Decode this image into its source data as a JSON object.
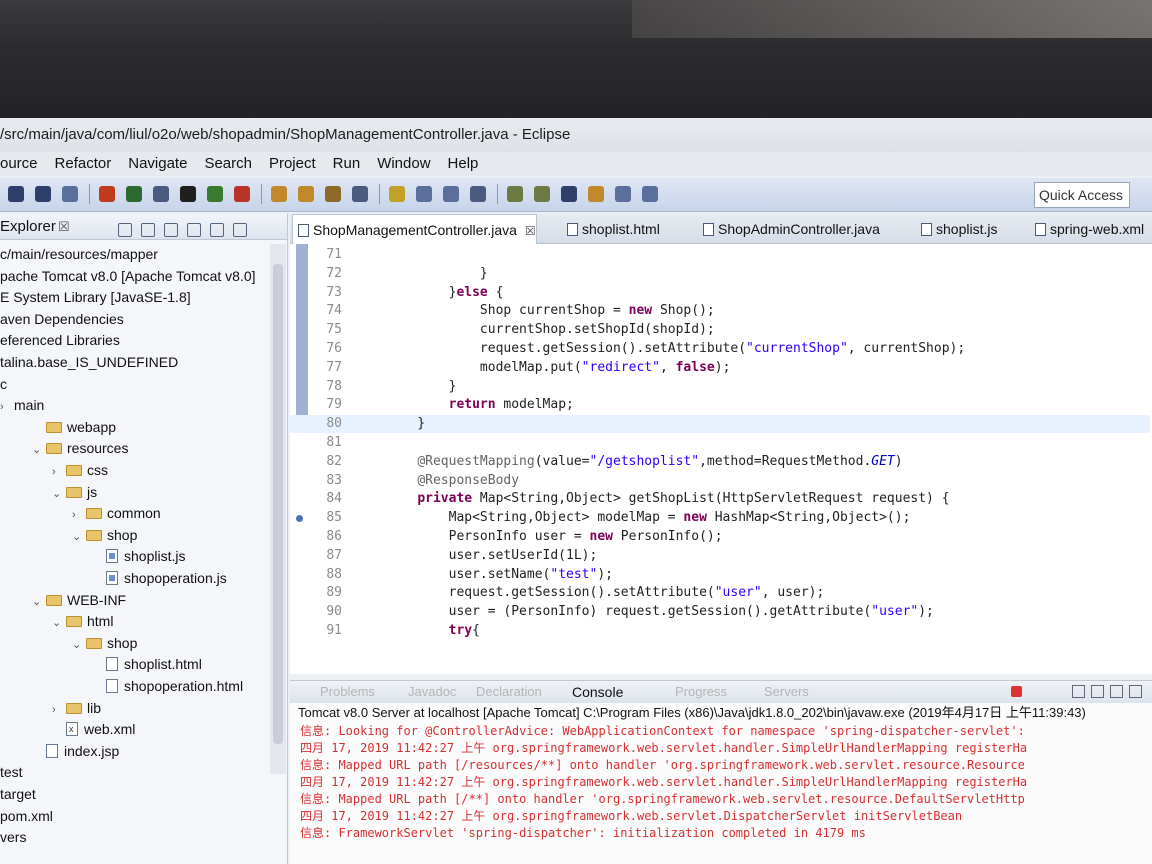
{
  "window": {
    "title": "/src/main/java/com/liul/o2o/web/shopadmin/ShopManagementController.java - Eclipse"
  },
  "menu": [
    "ource",
    "Refactor",
    "Navigate",
    "Search",
    "Project",
    "Run",
    "Window",
    "Help"
  ],
  "toolbar": {
    "quick_access": "Quick Access"
  },
  "explorer": {
    "title": "Explorer",
    "items": [
      {
        "label": "c/main/resources/mapper",
        "indent": 0,
        "type": "text"
      },
      {
        "label": "pache Tomcat v8.0 [Apache Tomcat v8.0]",
        "indent": 0,
        "type": "text"
      },
      {
        "label": "E System Library [JavaSE-1.8]",
        "indent": 0,
        "type": "text"
      },
      {
        "label": "aven Dependencies",
        "indent": 0,
        "type": "text"
      },
      {
        "label": "eferenced Libraries",
        "indent": 0,
        "type": "text"
      },
      {
        "label": "talina.base_IS_UNDEFINED",
        "indent": 0,
        "type": "text"
      },
      {
        "label": "c",
        "indent": 0,
        "type": "text"
      },
      {
        "label": "main",
        "indent": 0,
        "type": "text",
        "arrow": "›"
      },
      {
        "label": "webapp",
        "indent": 1,
        "type": "folder"
      },
      {
        "label": "resources",
        "indent": 1,
        "type": "folder",
        "arrow": "⌄"
      },
      {
        "label": "css",
        "indent": 2,
        "type": "folder",
        "arrow": "›"
      },
      {
        "label": "js",
        "indent": 2,
        "type": "folder",
        "arrow": "⌄"
      },
      {
        "label": "common",
        "indent": 3,
        "type": "folder",
        "arrow": "›"
      },
      {
        "label": "shop",
        "indent": 3,
        "type": "folder",
        "arrow": "⌄"
      },
      {
        "label": "shoplist.js",
        "indent": 4,
        "type": "js"
      },
      {
        "label": "shopoperation.js",
        "indent": 4,
        "type": "js"
      },
      {
        "label": "WEB-INF",
        "indent": 1,
        "type": "folder",
        "arrow": "⌄"
      },
      {
        "label": "html",
        "indent": 2,
        "type": "folder",
        "arrow": "⌄"
      },
      {
        "label": "shop",
        "indent": 3,
        "type": "folder",
        "arrow": "⌄"
      },
      {
        "label": "shoplist.html",
        "indent": 4,
        "type": "file"
      },
      {
        "label": "shopoperation.html",
        "indent": 4,
        "type": "file"
      },
      {
        "label": "lib",
        "indent": 2,
        "type": "folder",
        "arrow": "›"
      },
      {
        "label": "web.xml",
        "indent": 2,
        "type": "x"
      },
      {
        "label": "index.jsp",
        "indent": 1,
        "type": "file"
      },
      {
        "label": "test",
        "indent": 0,
        "type": "text"
      },
      {
        "label": "target",
        "indent": 0,
        "type": "text"
      },
      {
        "label": "pom.xml",
        "indent": 0,
        "type": "text"
      },
      {
        "label": "vers",
        "indent": 0,
        "type": "text"
      }
    ]
  },
  "editor": {
    "tabs": [
      {
        "label": "ShopManagementController.java",
        "close": "☒"
      },
      {
        "label": "shoplist.html"
      },
      {
        "label": "ShopAdminController.java"
      },
      {
        "label": "shoplist.js"
      },
      {
        "label": "spring-web.xml"
      }
    ],
    "lines": [
      {
        "n": "71",
        "code": ""
      },
      {
        "n": "72",
        "code": "            }"
      },
      {
        "n": "73",
        "code": "        }else {"
      },
      {
        "n": "74",
        "code": "            Shop currentShop = new Shop();"
      },
      {
        "n": "75",
        "code": "            currentShop.setShopId(shopId);"
      },
      {
        "n": "76",
        "code": "            request.getSession().setAttribute(\"currentShop\", currentShop);"
      },
      {
        "n": "77",
        "code": "            modelMap.put(\"redirect\", false);"
      },
      {
        "n": "78",
        "code": "        }"
      },
      {
        "n": "79",
        "code": "        return modelMap;"
      },
      {
        "n": "80",
        "code": "    }"
      },
      {
        "n": "81",
        "code": ""
      },
      {
        "n": "82",
        "code": "    @RequestMapping(value=\"/getshoplist\",method=RequestMethod.GET)"
      },
      {
        "n": "83",
        "code": "    @ResponseBody"
      },
      {
        "n": "84",
        "code": "    private Map<String,Object> getShopList(HttpServletRequest request) {"
      },
      {
        "n": "85",
        "code": "        Map<String,Object> modelMap = new HashMap<String,Object>();"
      },
      {
        "n": "86",
        "code": "        PersonInfo user = new PersonInfo();"
      },
      {
        "n": "87",
        "code": "        user.setUserId(1L);"
      },
      {
        "n": "88",
        "code": "        user.setName(\"test\");"
      },
      {
        "n": "89",
        "code": "        request.getSession().setAttribute(\"user\", user);"
      },
      {
        "n": "90",
        "code": "        user = (PersonInfo) request.getSession().getAttribute(\"user\");"
      },
      {
        "n": "91",
        "code": "        try{"
      }
    ]
  },
  "console": {
    "tabs": [
      "Problems",
      "Javadoc",
      "Declaration",
      "Console",
      "Progress",
      "Servers"
    ],
    "active_tab": "Console",
    "title": "Tomcat v8.0 Server at localhost [Apache Tomcat] C:\\Program Files (x86)\\Java\\jdk1.8.0_202\\bin\\javaw.exe (2019年4月17日 上午11:39:43)",
    "lines": [
      "信息: Looking for @ControllerAdvice: WebApplicationContext for namespace 'spring-dispatcher-servlet':",
      "四月 17, 2019 11:42:27 上午 org.springframework.web.servlet.handler.SimpleUrlHandlerMapping registerHa",
      "信息: Mapped URL path [/resources/**] onto handler 'org.springframework.web.servlet.resource.Resource",
      "四月 17, 2019 11:42:27 上午 org.springframework.web.servlet.handler.SimpleUrlHandlerMapping registerHa",
      "信息: Mapped URL path [/**] onto handler 'org.springframework.web.servlet.resource.DefaultServletHttp",
      "四月 17, 2019 11:42:27 上午 org.springframework.web.servlet.DispatcherServlet initServletBean",
      "信息: FrameworkServlet 'spring-dispatcher': initialization completed in 4179 ms"
    ]
  }
}
